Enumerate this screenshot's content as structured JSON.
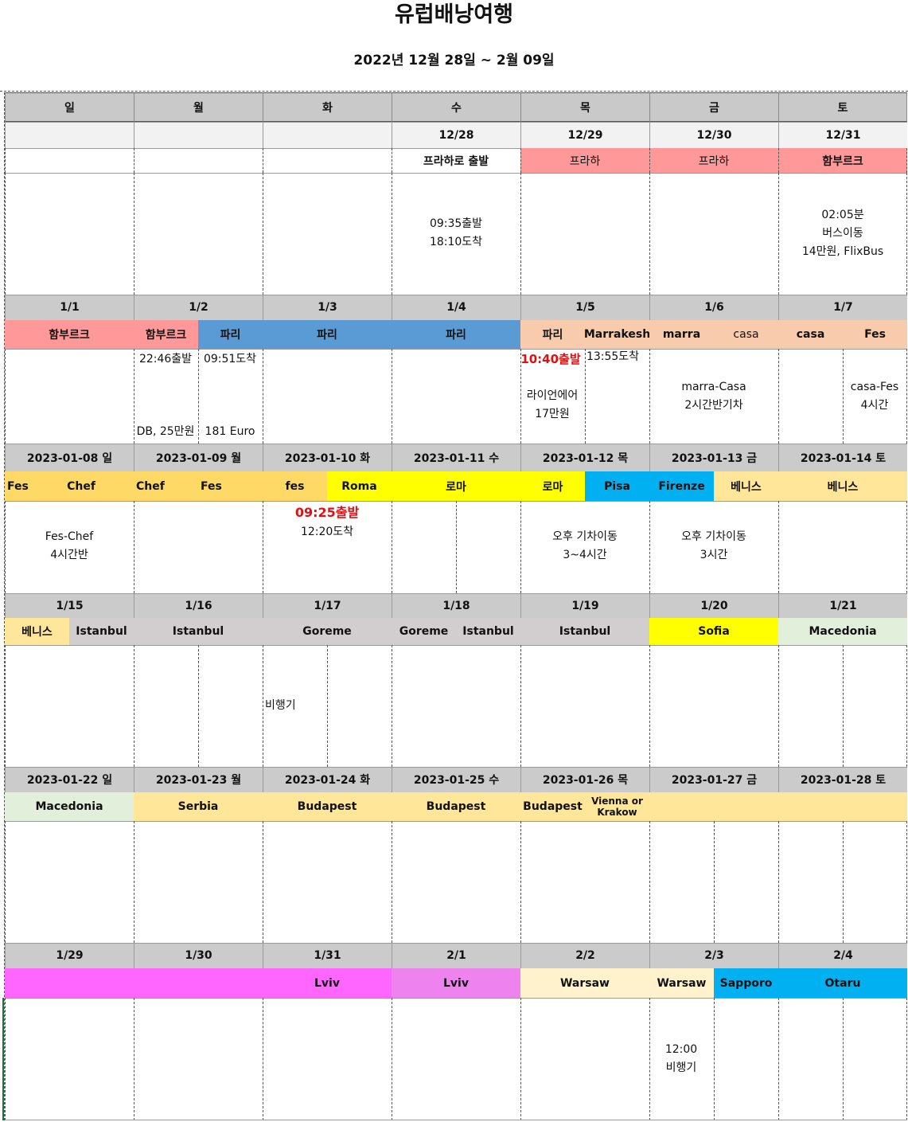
{
  "title": "유럽배낭여행",
  "subtitle": "2022년 12월 28일 ~ 2월 09일",
  "weekdays": [
    "일",
    "월",
    "화",
    "수",
    "목",
    "금",
    "토"
  ],
  "colors": {
    "pink": "#ff9999",
    "blue": "#5b9bd5",
    "peach": "#f8cbad",
    "gold": "#ffd966",
    "yellow": "#ffff00",
    "cyan": "#00b0f0",
    "lightyellow": "#ffe699",
    "gray": "#d0cece",
    "mint": "#e2efda",
    "magenta": "#ff66ff",
    "violet": "#ee82ee",
    "cream": "#fff2cc"
  },
  "weeks": [
    {
      "dates": [
        "",
        "",
        "",
        "12/28",
        "12/29",
        "12/30",
        "12/31"
      ],
      "places": [
        {
          "text": "프라하로 출발",
          "color": "",
          "bold": true
        },
        {
          "text": "프라하",
          "color": "pink"
        },
        {
          "text": "프라하",
          "color": "pink"
        },
        {
          "text": "함부르크",
          "color": "pink",
          "bold": true
        }
      ],
      "notes": [
        {
          "lines": [
            "09:35출발",
            "18:10도착"
          ]
        },
        {
          "lines": [
            "02:05분",
            "버스이동",
            "14만원, FlixBus"
          ]
        }
      ]
    },
    {
      "dates": [
        "1/1",
        "1/2",
        "1/3",
        "1/4",
        "1/5",
        "1/6",
        "1/7"
      ],
      "places": [
        {
          "text": "함부르크",
          "color": "pink",
          "bold": true
        },
        {
          "text": "함부르크",
          "color": "pink",
          "bold": true
        },
        {
          "text": "파리",
          "color": "blue",
          "bold": true
        },
        {
          "text": "파리",
          "color": "blue",
          "bold": true
        },
        {
          "text": "파리",
          "color": "blue",
          "bold": true
        },
        {
          "text": "파리",
          "color": "peach",
          "bold": true
        },
        {
          "text": "Marrakesh",
          "color": "peach",
          "bold": true
        },
        {
          "text": "marra",
          "color": "peach",
          "bold": true
        },
        {
          "text": "casa",
          "color": "peach"
        },
        {
          "text": "casa",
          "color": "peach",
          "bold": true
        },
        {
          "text": "Fes",
          "color": "peach",
          "bold": true
        }
      ],
      "notes": [
        {
          "text": "22:46출발"
        },
        {
          "text": "DB, 25만원"
        },
        {
          "text": "09:51도착"
        },
        {
          "text": "181 Euro"
        },
        {
          "text": "10:40출발",
          "red": true
        },
        {
          "lines": [
            "라이언에어",
            "17만원"
          ]
        },
        {
          "text": "13:55도착"
        },
        {
          "lines": [
            "marra-Casa",
            "2시간반기차"
          ]
        },
        {
          "lines": [
            "casa-Fes",
            "4시간"
          ]
        }
      ]
    },
    {
      "dates": [
        "2023-01-08  일",
        "2023-01-09   월",
        "2023-01-10   화",
        "2023-01-11  수",
        "2023-01-12   목",
        "2023-01-13   금",
        "2023-01-14   토"
      ],
      "places": [
        {
          "text": "Fes",
          "color": "gold",
          "bold": true
        },
        {
          "text": "Chef",
          "color": "gold",
          "bold": true
        },
        {
          "text": "Chef",
          "color": "gold",
          "bold": true
        },
        {
          "text": "Fes",
          "color": "gold",
          "bold": true
        },
        {
          "text": "fes",
          "color": "gold",
          "bold": true
        },
        {
          "text": "Roma",
          "color": "yellow",
          "bold": true
        },
        {
          "text": "로마",
          "color": "yellow",
          "bold": true
        },
        {
          "text": "로마",
          "color": "yellow",
          "bold": true
        },
        {
          "text": "Pisa",
          "color": "cyan",
          "bold": true
        },
        {
          "text": "Firenze",
          "color": "cyan",
          "bold": true
        },
        {
          "text": "베니스",
          "color": "lightyellow",
          "bold": true
        },
        {
          "text": "베니스",
          "color": "lightyellow",
          "bold": true
        }
      ],
      "notes": [
        {
          "lines": [
            "Fes-Chef",
            "4시간반"
          ]
        },
        {
          "text": "09:25출발",
          "red": true
        },
        {
          "text": "12:20도착"
        },
        {
          "lines": [
            "오후 기차이동",
            "3~4시간"
          ]
        },
        {
          "lines": [
            "오후 기차이동",
            "3시간"
          ]
        }
      ]
    },
    {
      "dates": [
        "1/15",
        "1/16",
        "1/17",
        "1/18",
        "1/19",
        "1/20",
        "1/21"
      ],
      "places": [
        {
          "text": "베니스",
          "color": "lightyellow",
          "bold": true
        },
        {
          "text": "Istanbul",
          "color": "gray",
          "bold": true
        },
        {
          "text": "Istanbul",
          "color": "gray",
          "bold": true
        },
        {
          "text": "Goreme",
          "color": "gray",
          "bold": true
        },
        {
          "text": "Goreme",
          "color": "gray",
          "bold": true
        },
        {
          "text": "Istanbul",
          "color": "gray",
          "bold": true
        },
        {
          "text": "Istanbul",
          "color": "gray",
          "bold": true
        },
        {
          "text": "Sofia",
          "color": "yellow",
          "bold": true
        },
        {
          "text": "Macedonia",
          "color": "mint",
          "bold": true
        }
      ],
      "notes": [
        {
          "text": "비행기"
        }
      ]
    },
    {
      "dates": [
        "2023-01-22   일",
        "2023-01-23   월",
        "2023-01-24  화",
        "2023-01-25  수",
        "2023-01-26   목",
        "2023-01-27   금",
        "2023-01-28   토"
      ],
      "places": [
        {
          "text": "Macedonia",
          "color": "mint",
          "bold": true
        },
        {
          "text": "Serbia",
          "color": "lightyellow",
          "bold": true
        },
        {
          "text": "Budapest",
          "color": "lightyellow",
          "bold": true
        },
        {
          "text": "Budapest",
          "color": "lightyellow",
          "bold": true
        },
        {
          "text": "Budapest",
          "color": "lightyellow",
          "bold": true
        },
        {
          "text": "Vienna or",
          "color": "lightyellow",
          "bold": true
        },
        {
          "text": "Krakow",
          "color": "lightyellow",
          "bold": true
        }
      ],
      "notes": []
    },
    {
      "dates": [
        "1/29",
        "1/30",
        "1/31",
        "2/1",
        "2/2",
        "2/3",
        "2/4"
      ],
      "places": [
        {
          "text": "Lviv",
          "color": "magenta",
          "bold": true
        },
        {
          "text": "Lviv",
          "color": "violet",
          "bold": true
        },
        {
          "text": "Warsaw",
          "color": "cream",
          "bold": true
        },
        {
          "text": "Warsaw",
          "color": "cream",
          "bold": true
        },
        {
          "text": "Sapporo",
          "color": "cyan",
          "bold": true
        },
        {
          "text": "Otaru",
          "color": "cyan",
          "bold": true
        }
      ],
      "notes": [
        {
          "lines": [
            "12:00",
            "비행기"
          ]
        }
      ]
    }
  ]
}
